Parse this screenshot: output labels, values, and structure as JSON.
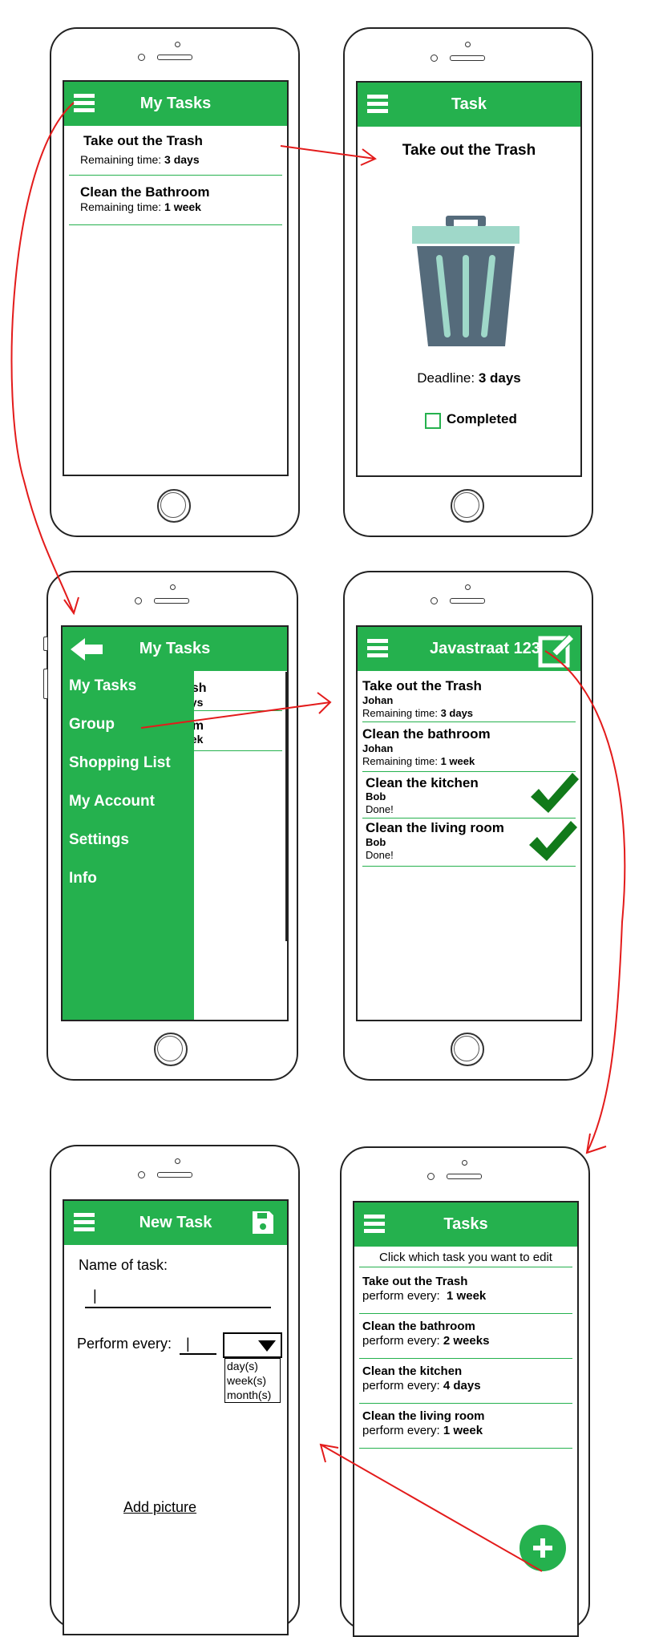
{
  "colors": {
    "green": "#25b14e",
    "arrow": "#e31b1b",
    "check": "#117a1a",
    "bin_lid": "#9fd8c9",
    "bin_body": "#556b7b"
  },
  "screen1": {
    "title": "My Tasks",
    "tasks": [
      {
        "name": "Take out the Trash",
        "label": "Remaining time:",
        "value": "3 days"
      },
      {
        "name": "Clean the Bathroom",
        "label": "Remaining time:",
        "value": "1 week"
      }
    ]
  },
  "screen2": {
    "title": "Task",
    "task_name": "Take out the Trash",
    "deadline_label": "Deadline:",
    "deadline_value": "3 days",
    "completed_label": "Completed"
  },
  "screen3": {
    "title": "My Tasks",
    "menu": [
      "My Tasks",
      "Group",
      "Shopping List",
      "My Account",
      "Settings",
      "Info"
    ],
    "peek": [
      "ash",
      "ays",
      "om",
      "eek"
    ]
  },
  "screen4": {
    "title": "Javastraat 123",
    "tasks": [
      {
        "name": "Take out the Trash",
        "person": "Johan",
        "status_label": "Remaining time:",
        "status_value": "3 days"
      },
      {
        "name": "Clean the bathroom",
        "person": "Johan",
        "status_label": "Remaining time:",
        "status_value": "1 week"
      },
      {
        "name": "Clean the kitchen",
        "person": "Bob",
        "status_label": "Done!",
        "status_value": ""
      },
      {
        "name": "Clean the living room",
        "person": "Bob",
        "status_label": "Done!",
        "status_value": ""
      }
    ]
  },
  "screen5": {
    "title": "New Task",
    "name_label": "Name of task:",
    "name_value": "|",
    "perform_label": "Perform every:",
    "perform_value": "|",
    "options": [
      "day(s)",
      "week(s)",
      "month(s)"
    ],
    "add_picture": "Add picture"
  },
  "screen6": {
    "title": "Tasks",
    "hint": "Click which task you want to edit",
    "tasks": [
      {
        "name": "Take out the Trash",
        "label": "perform every:",
        "value": "1 week"
      },
      {
        "name": "Clean the bathroom",
        "label": "perform every:",
        "value": "2 weeks"
      },
      {
        "name": "Clean the kitchen",
        "label": "perform every:",
        "value": "4 days"
      },
      {
        "name": "Clean the living room",
        "label": "perform every:",
        "value": "1 week"
      }
    ]
  }
}
